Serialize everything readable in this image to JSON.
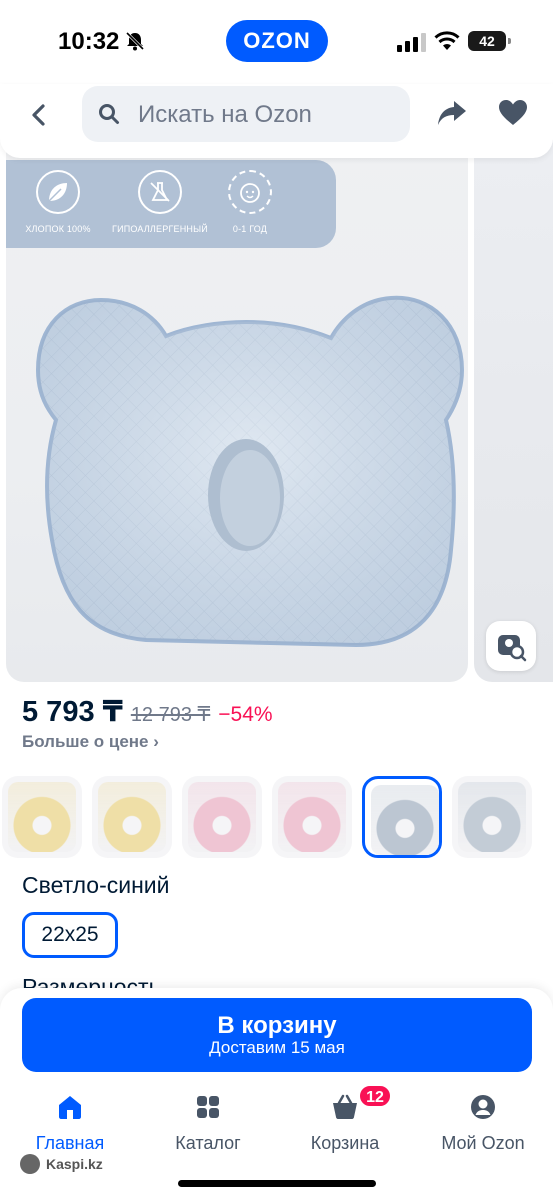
{
  "status": {
    "time": "10:32",
    "battery": "42",
    "logo": "OZON"
  },
  "search": {
    "placeholder": "Искать на Ozon"
  },
  "gallery": {
    "features": [
      "ХЛОПОК 100%",
      "ГИПОАЛЛЕРГЕННЫЙ",
      "0-1 ГОД"
    ]
  },
  "product": {
    "price": "5 793 ₸",
    "old_price": "12 793 ₸",
    "discount": "−54%",
    "more_price": "Больше о цене ›",
    "color_name": "Светло-синий",
    "size": "22x25",
    "size_section": "Размерность"
  },
  "variants": [
    {
      "color": "#efdfa7",
      "selected": false
    },
    {
      "color": "#efdfa7",
      "selected": false
    },
    {
      "color": "#efc5d3",
      "selected": false
    },
    {
      "color": "#efc5d3",
      "selected": false
    },
    {
      "color": "#bcc6d2",
      "selected": true
    },
    {
      "color": "#c3ccd6",
      "selected": false
    }
  ],
  "cart": {
    "title": "В корзину",
    "subtitle": "Доставим 15 мая"
  },
  "tabs": [
    {
      "label": "Главная",
      "icon": "home-icon",
      "active": true
    },
    {
      "label": "Каталог",
      "icon": "catalog-icon",
      "active": false
    },
    {
      "label": "Корзина",
      "icon": "cart-icon",
      "active": false,
      "badge": "12"
    },
    {
      "label": "Мой Ozon",
      "icon": "profile-icon",
      "active": false
    }
  ],
  "watermark": "Kaspi.kz",
  "colors": {
    "accent": "#005bff",
    "discount": "#f91155",
    "text": "#001a34"
  }
}
